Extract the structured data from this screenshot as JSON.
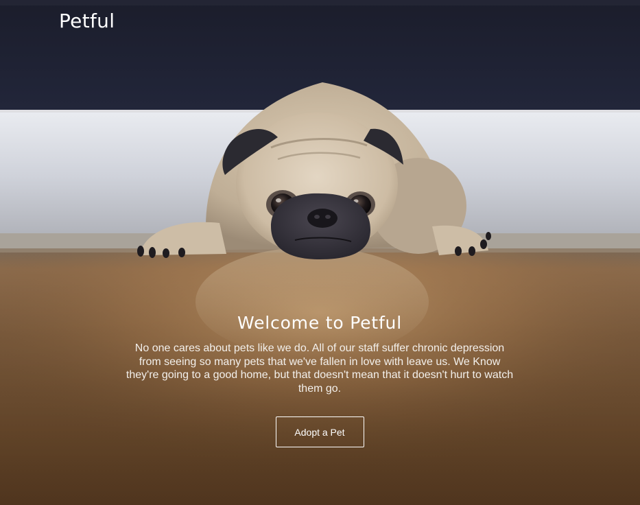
{
  "header": {
    "logo_text": "Petful"
  },
  "hero": {
    "title": "Welcome to Petful",
    "description": "No one cares about pets like we do. All of our staff suffer chronic depression from seeing so many pets that we've fallen in love with leave us. We Know they're going to a good home, but that doesn't mean that it doesn't hurt to watch them go.",
    "cta_label": "Adopt a Pet",
    "background_image": "pug-lying-on-wood-floor"
  },
  "colors": {
    "text": "#ffffff",
    "wall_dark": "#1c1e2c",
    "floor": "#8a5a2e"
  }
}
